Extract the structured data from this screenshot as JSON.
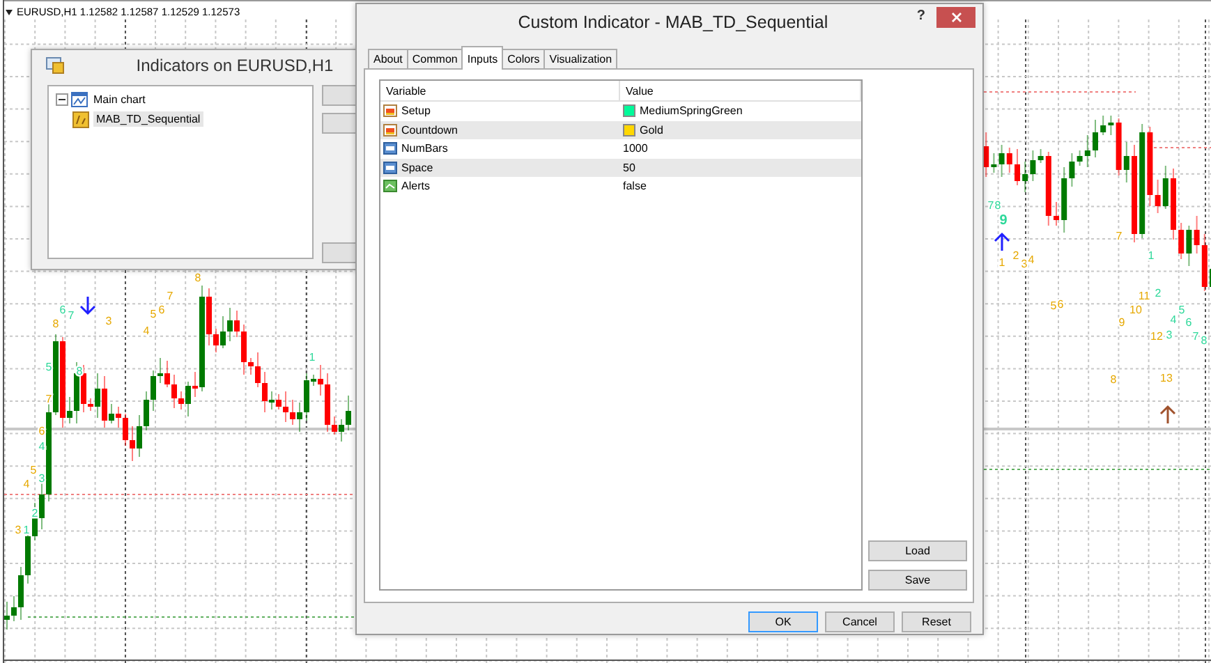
{
  "chart": {
    "header": "EURUSD,H1  1.12582 1.12587 1.12529 1.12573",
    "labels": [
      {
        "text": "8",
        "color": "#e6a800"
      },
      {
        "text": "6",
        "color": "#2ed89a"
      },
      {
        "text": "7",
        "color": "#2ed89a"
      },
      {
        "text": "8",
        "color": "#e6a800"
      },
      {
        "text": "3",
        "color": "#e6a800"
      },
      {
        "text": "4",
        "color": "#e6a800"
      },
      {
        "text": "5",
        "color": "#e6a800"
      },
      {
        "text": "6",
        "color": "#e6a800"
      },
      {
        "text": "7",
        "color": "#e6a800"
      },
      {
        "text": "5",
        "color": "#2ed89a"
      },
      {
        "text": "8",
        "color": "#2ed89a"
      },
      {
        "text": "7",
        "color": "#e6a800"
      },
      {
        "text": "1",
        "color": "#2ed89a"
      },
      {
        "text": "6",
        "color": "#e6a800"
      },
      {
        "text": "4",
        "color": "#2ed89a"
      },
      {
        "text": "5",
        "color": "#e6a800"
      },
      {
        "text": "3",
        "color": "#2ed89a"
      },
      {
        "text": "4",
        "color": "#e6a800"
      },
      {
        "text": "2",
        "color": "#2ed89a"
      },
      {
        "text": "3",
        "color": "#e6a800"
      },
      {
        "text": "1",
        "color": "#2ed89a"
      },
      {
        "text": "7",
        "color": "#2ed89a"
      },
      {
        "text": "8",
        "color": "#2ed89a"
      },
      {
        "text": "9",
        "color": "#2ed89a",
        "emphasis": true
      },
      {
        "text": "1",
        "color": "#e6a800"
      },
      {
        "text": "2",
        "color": "#e6a800"
      },
      {
        "text": "3",
        "color": "#e6a800"
      },
      {
        "text": "4",
        "color": "#e6a800"
      },
      {
        "text": "5",
        "color": "#e6a800"
      },
      {
        "text": "6",
        "color": "#e6a800"
      },
      {
        "text": "7",
        "color": "#e6a800"
      },
      {
        "text": "1",
        "color": "#2ed89a"
      },
      {
        "text": "11",
        "color": "#e6a800"
      },
      {
        "text": "2",
        "color": "#2ed89a"
      },
      {
        "text": "10",
        "color": "#e6a800"
      },
      {
        "text": "5",
        "color": "#2ed89a"
      },
      {
        "text": "9",
        "color": "#e6a800"
      },
      {
        "text": "4",
        "color": "#2ed89a"
      },
      {
        "text": "6",
        "color": "#2ed89a"
      },
      {
        "text": "12",
        "color": "#e6a800"
      },
      {
        "text": "3",
        "color": "#2ed89a"
      },
      {
        "text": "7",
        "color": "#2ed89a"
      },
      {
        "text": "8",
        "color": "#2ed89a"
      },
      {
        "text": "8",
        "color": "#e6a800"
      },
      {
        "text": "13",
        "color": "#e6a800"
      }
    ]
  },
  "indicators_dialog": {
    "title": "Indicators on EURUSD,H1",
    "tree": [
      {
        "label": "Main chart",
        "expanded": true,
        "selected": false,
        "children": [
          {
            "label": "MAB_TD_Sequential",
            "selected": true
          }
        ]
      }
    ]
  },
  "custom_indicator_dialog": {
    "title": "Custom Indicator - MAB_TD_Sequential",
    "help": "?",
    "tabs": [
      {
        "label": "About",
        "selected": false
      },
      {
        "label": "Common",
        "selected": false
      },
      {
        "label": "Inputs",
        "selected": true
      },
      {
        "label": "Colors",
        "selected": false
      },
      {
        "label": "Visualization",
        "selected": false
      }
    ],
    "table": {
      "columns": [
        "Variable",
        "Value"
      ],
      "rows": [
        {
          "kind": "color",
          "variable": "Setup",
          "value": "MediumSpringGreen",
          "color": "#00fa9a"
        },
        {
          "kind": "color",
          "variable": "Countdown",
          "value": "Gold",
          "color": "#ffd700"
        },
        {
          "kind": "number",
          "variable": "NumBars",
          "value": "1000"
        },
        {
          "kind": "number",
          "variable": "Space",
          "value": "50"
        },
        {
          "kind": "bool",
          "variable": "Alerts",
          "value": "false"
        }
      ]
    },
    "side_buttons": [
      "Load",
      "Save"
    ],
    "buttons": [
      {
        "label": "OK",
        "default": true
      },
      {
        "label": "Cancel",
        "default": false
      },
      {
        "label": "Reset",
        "default": false
      }
    ]
  }
}
